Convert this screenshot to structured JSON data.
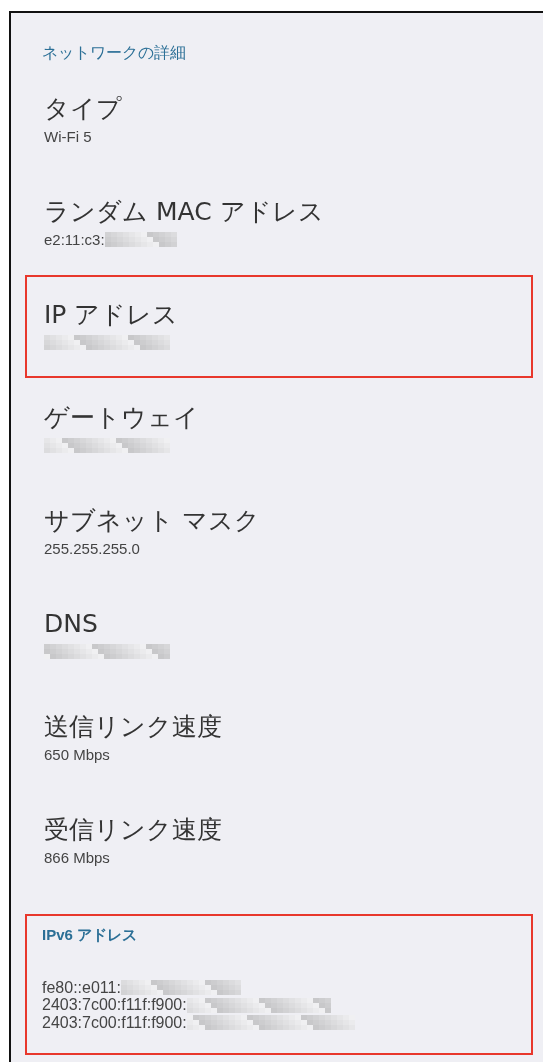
{
  "section_title": "ネットワークの詳細",
  "items": [
    {
      "title": "タイプ",
      "value": "Wi-Fi 5",
      "masked": false,
      "highlighted": false
    },
    {
      "title": "ランダム MAC アドレス",
      "value": "e2:11:c3:",
      "masked": true,
      "highlighted": false
    },
    {
      "title": "IP アドレス",
      "masked": true,
      "highlighted": true
    },
    {
      "title": "ゲートウェイ",
      "masked": true,
      "highlighted": false
    },
    {
      "title": "サブネット マスク",
      "value": "255.255.255.0",
      "masked": false,
      "highlighted": false
    },
    {
      "title": "DNS",
      "masked": true,
      "highlighted": false
    },
    {
      "title": "送信リンク速度",
      "value": "650 Mbps",
      "masked": false,
      "highlighted": false
    },
    {
      "title": "受信リンク速度",
      "value": "866 Mbps",
      "masked": false,
      "highlighted": false
    }
  ],
  "ipv6": {
    "title": "IPv6 アドレス",
    "highlighted": true,
    "lines": [
      {
        "value": "fe80::e011:",
        "masked": true
      },
      {
        "value": "2403:7c00:f11f:f900:",
        "masked": true
      },
      {
        "value": "2403:7c00:f11f:f900:",
        "masked": true
      }
    ]
  }
}
